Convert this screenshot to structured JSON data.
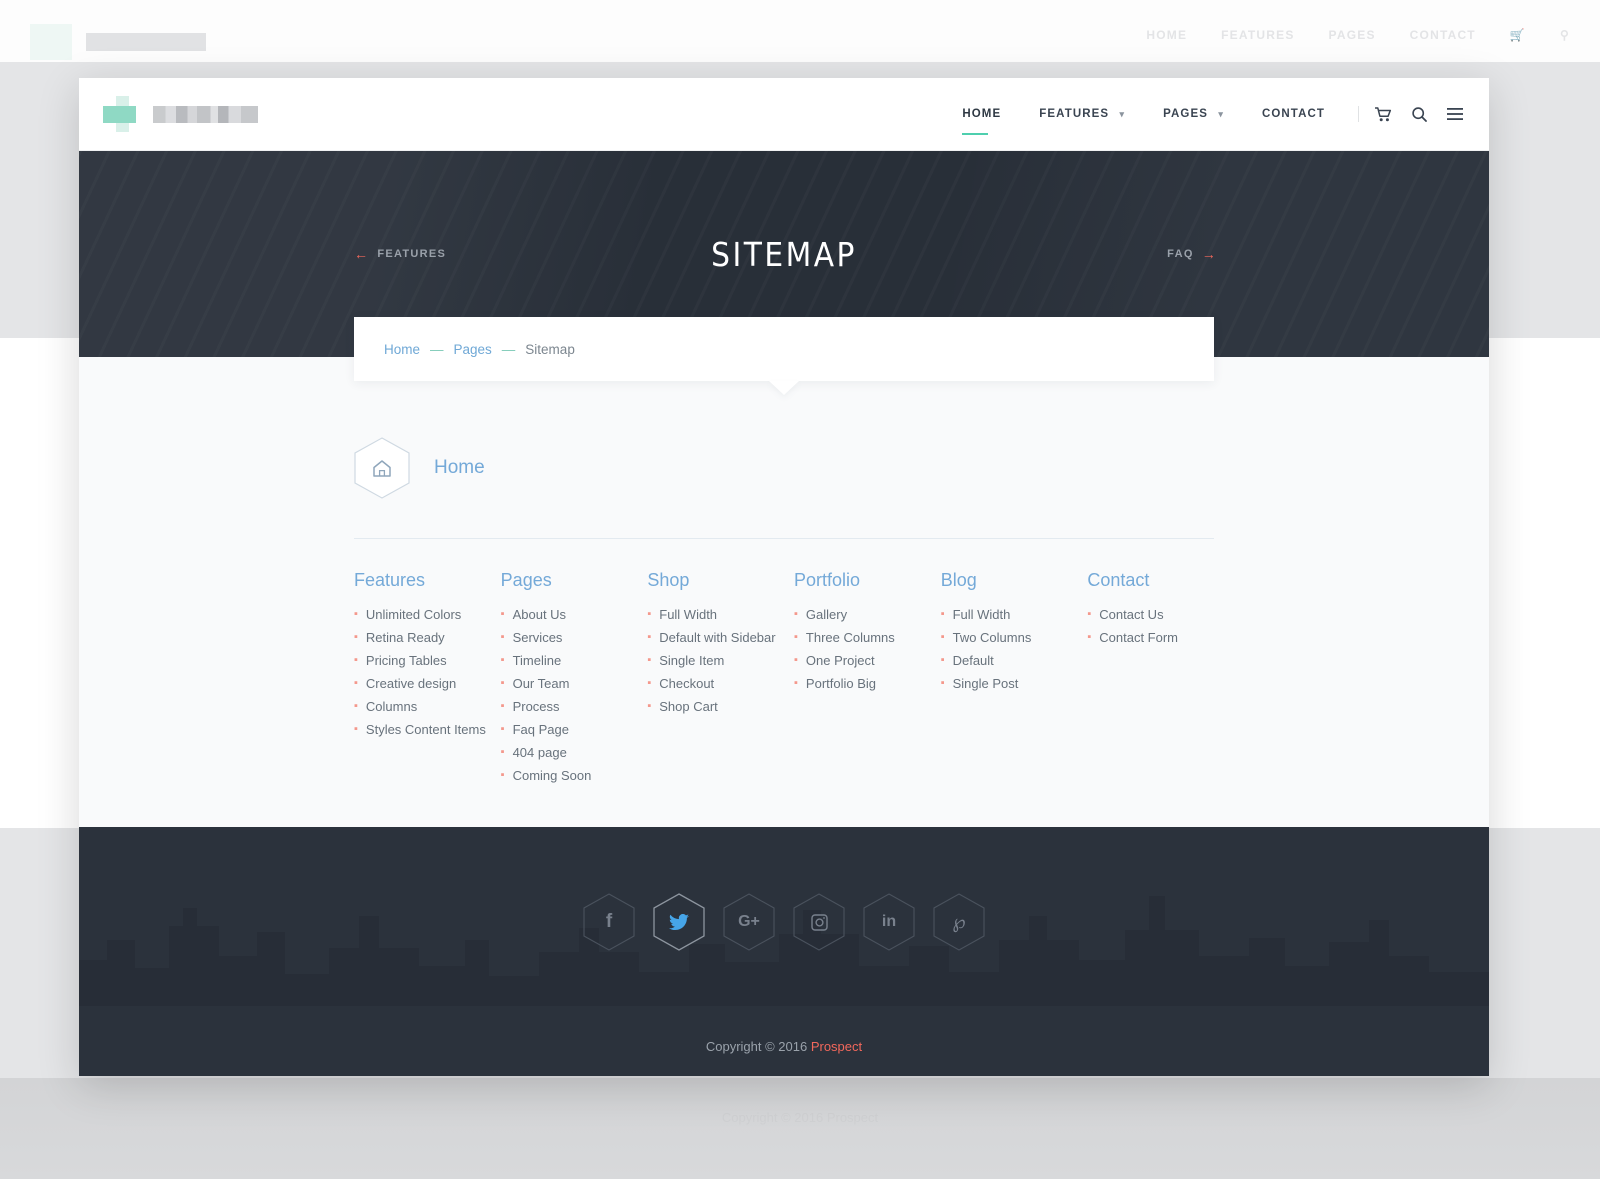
{
  "background": {
    "nav_items": [
      "HOME",
      "FEATURES",
      "PAGES",
      "CONTACT"
    ],
    "copyright": "Copyright © 2016 Prospect"
  },
  "header": {
    "logo_alt": "Prospect",
    "nav": [
      {
        "label": "HOME",
        "has_caret": false,
        "active": true
      },
      {
        "label": "FEATURES",
        "has_caret": true,
        "active": false
      },
      {
        "label": "PAGES",
        "has_caret": true,
        "active": false
      },
      {
        "label": "CONTACT",
        "has_caret": false,
        "active": false
      }
    ],
    "icons": [
      "cart-icon",
      "search-icon",
      "menu-icon"
    ],
    "accent": "#4ecfae"
  },
  "hero": {
    "title": "SITEMAP",
    "prev_label": "FEATURES",
    "next_label": "FAQ",
    "arrow_color": "#f2685c",
    "background": "#2b323c"
  },
  "breadcrumb": {
    "items": [
      {
        "label": "Home",
        "link": true
      },
      {
        "label": "Pages",
        "link": true
      },
      {
        "label": "Sitemap",
        "link": false
      }
    ],
    "separator": "—",
    "link_color": "#6fa8d6",
    "separator_color": "#7fcbb8"
  },
  "sitemap": {
    "home_label": "Home",
    "home_icon": "home-icon",
    "columns": [
      {
        "title": "Features",
        "items": [
          "Unlimited Colors",
          "Retina Ready",
          "Pricing Tables",
          "Creative design",
          "Columns",
          "Styles Content Items"
        ]
      },
      {
        "title": "Pages",
        "items": [
          "About Us",
          "Services",
          "Timeline",
          "Our Team",
          "Process",
          "Faq Page",
          "404 page",
          "Coming Soon"
        ]
      },
      {
        "title": "Shop",
        "items": [
          "Full Width",
          "Default with Sidebar",
          "Single Item",
          "Checkout",
          "Shop Cart"
        ]
      },
      {
        "title": "Portfolio",
        "items": [
          "Gallery",
          "Three Columns",
          "One Project",
          "Portfolio Big"
        ]
      },
      {
        "title": "Blog",
        "items": [
          "Full Width",
          "Two Columns",
          "Default",
          "Single Post"
        ]
      },
      {
        "title": "Contact",
        "items": [
          "Contact Us",
          "Contact Form"
        ]
      }
    ],
    "heading_color": "#74a9d8",
    "bullet_color": "#f4978b"
  },
  "footer": {
    "socials": [
      {
        "name": "facebook-icon",
        "glyph": "f",
        "active": false
      },
      {
        "name": "twitter-icon",
        "glyph": "",
        "active": true
      },
      {
        "name": "google-plus-icon",
        "glyph": "G+",
        "active": false
      },
      {
        "name": "instagram-icon",
        "glyph": "",
        "active": false
      },
      {
        "name": "linkedin-icon",
        "glyph": "in",
        "active": false
      },
      {
        "name": "pinterest-icon",
        "glyph": "",
        "active": false
      }
    ],
    "copyright_prefix": "Copyright © 2016 ",
    "copyright_brand": "Prospect",
    "background": "#2b323c"
  }
}
